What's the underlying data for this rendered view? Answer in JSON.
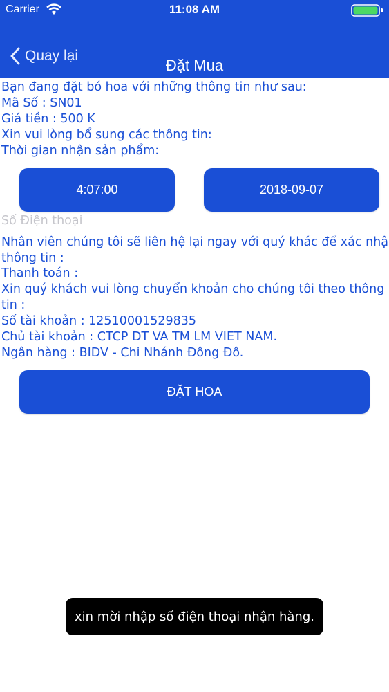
{
  "status_bar": {
    "carrier": "Carrier",
    "time": "11:08 AM",
    "wifi_icon": "wifi-icon",
    "battery_icon": "battery-icon"
  },
  "nav": {
    "back_label": "Quay lại",
    "back_icon": "chevron-left-icon",
    "title": "Đặt Mua"
  },
  "order_info": {
    "intro": "Bạn đang đặt bó hoa với những thông tin như sau:",
    "code": "Mã Số : SN01",
    "price": "Giá tiền : 500 K",
    "supplement_prompt": "Xin vui lòng bổ sung các thông tin:",
    "receive_time_label": "Thời gian nhận sản phẩm:"
  },
  "pickers": {
    "time_value": "4:07:00",
    "date_value": "2018-09-07"
  },
  "phone": {
    "placeholder": "Số Điện thoại",
    "value": ""
  },
  "contact_note": {
    "line1": "Nhân viên chúng tôi sẽ liên hệ lại ngay với quý khác để xác nhận",
    "line2": "thông tin :"
  },
  "payment": {
    "heading": "Thanh toán :",
    "instruction_line1": "Xin quý khách vui lòng chuyển khoản cho chúng tôi theo thông",
    "instruction_line2": "tin :",
    "account_number": "Số tài khoản : 12510001529835",
    "account_holder": "Chủ tài khoản : CTCP DT VA TM LM VIET NAM.",
    "bank": "Ngân hàng  : BIDV - Chi Nhánh Đông Đô."
  },
  "submit": {
    "label": "ĐẶT HOA"
  },
  "toast": {
    "message": "xin mời nhập số điện thoại nhận hàng."
  },
  "colors": {
    "primary": "#1a4fd6",
    "background": "#ffffff",
    "placeholder": "#c5c5cb",
    "battery": "#4cd964"
  }
}
